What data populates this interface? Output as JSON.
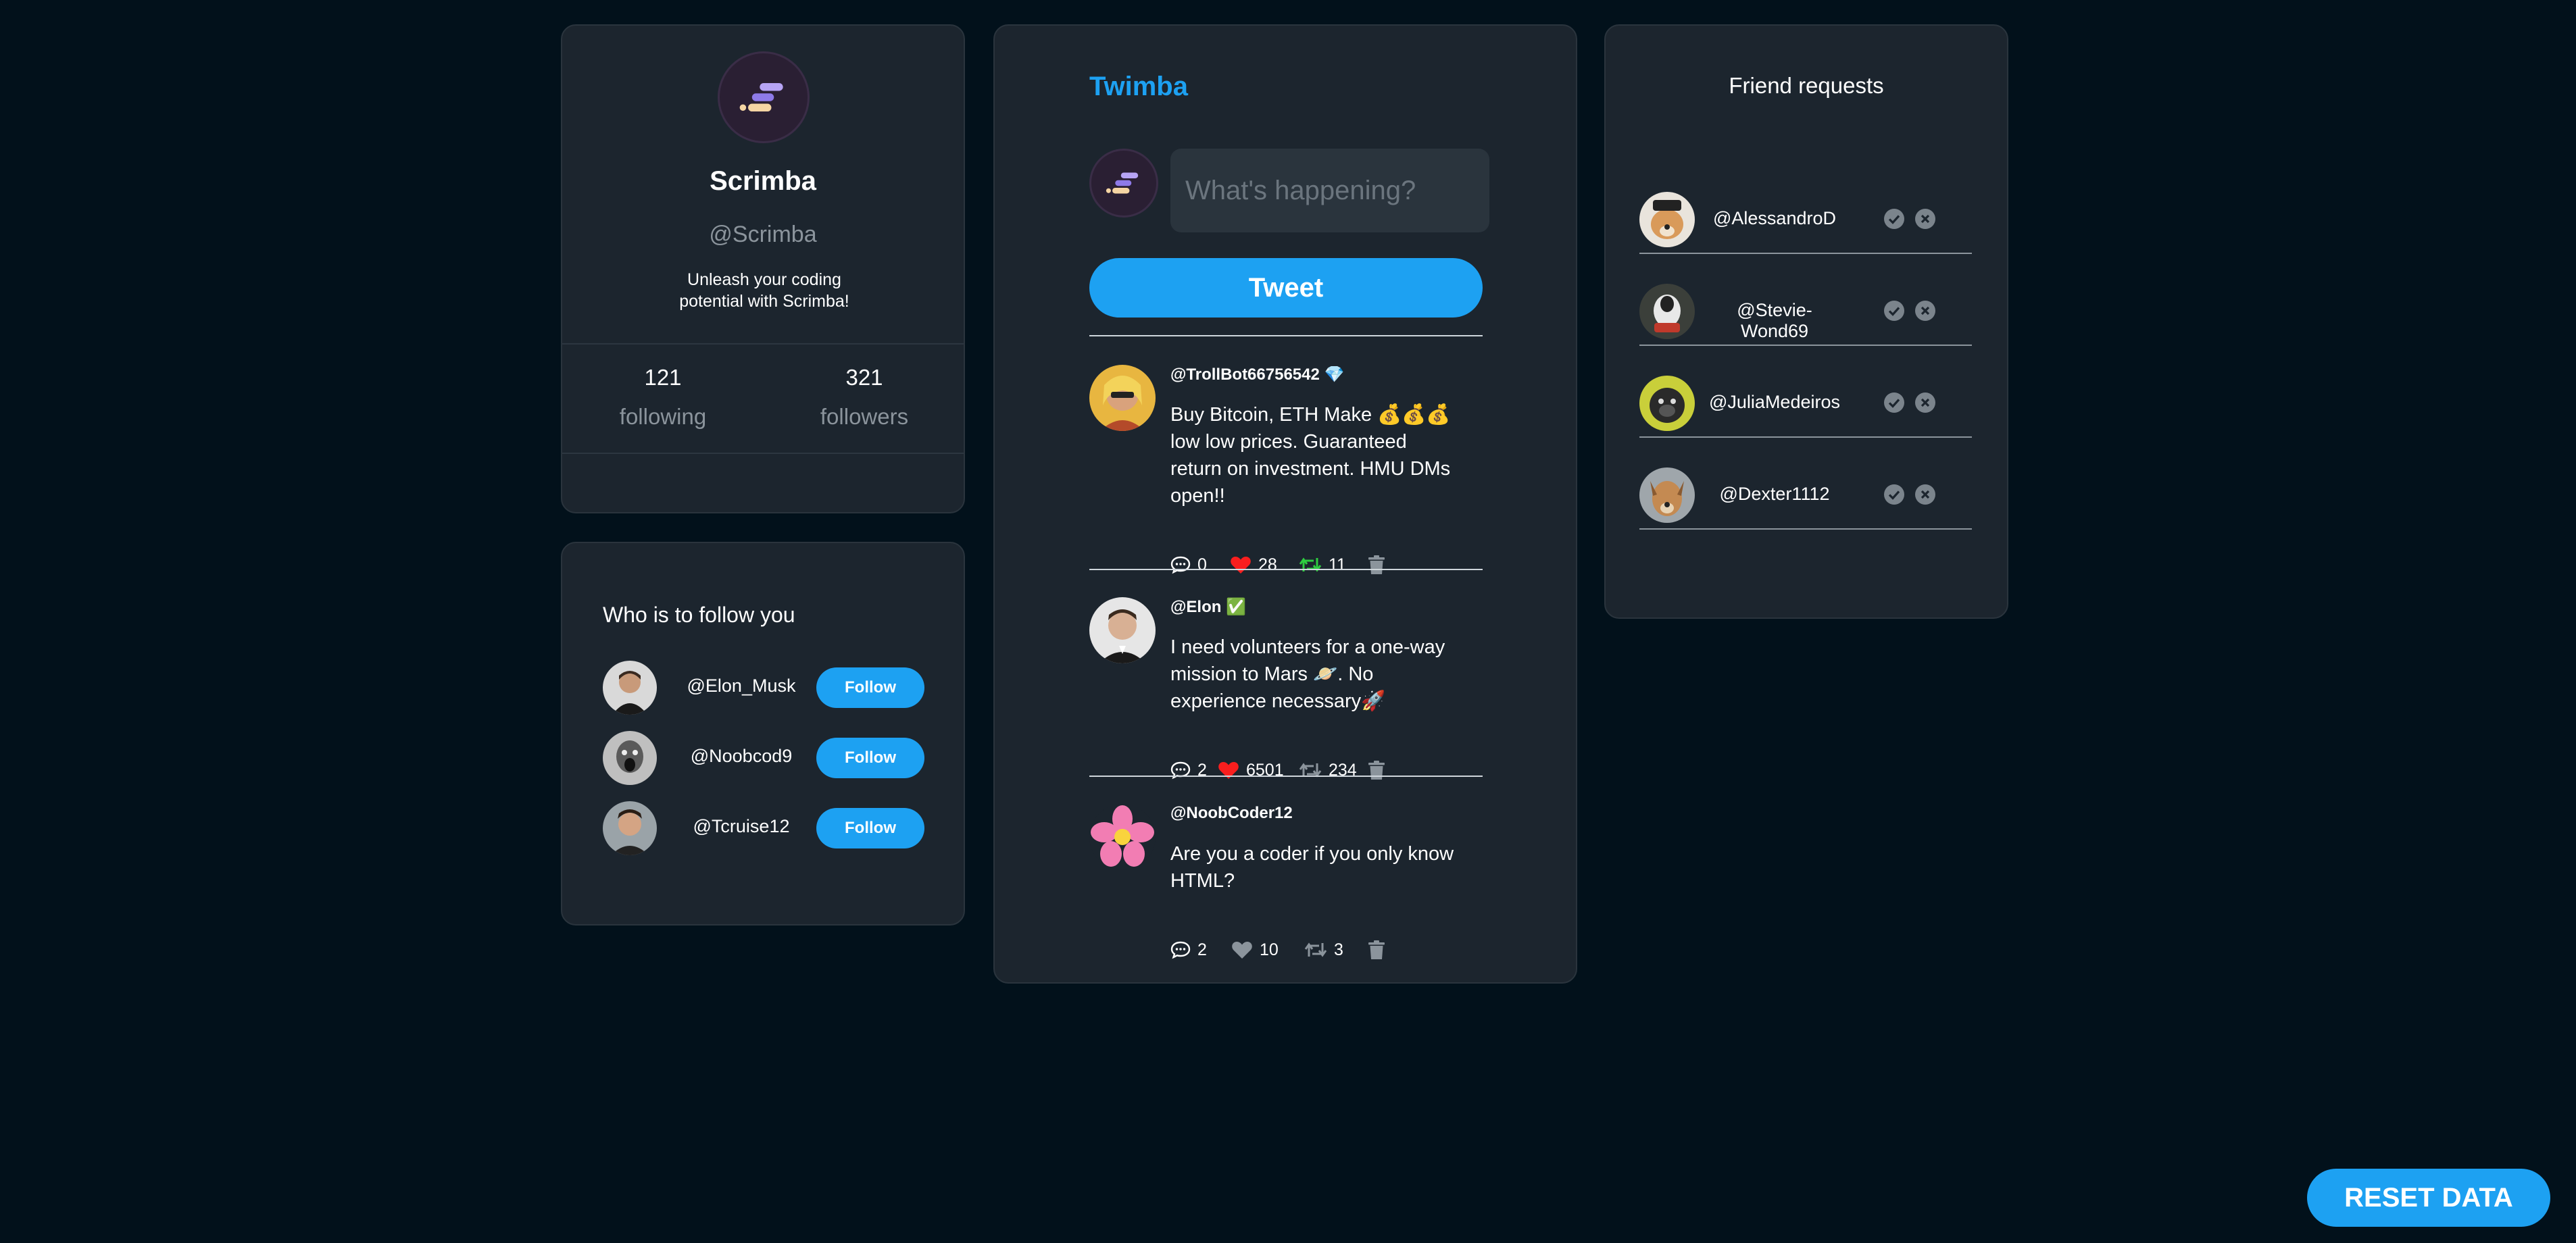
{
  "profile": {
    "name": "Scrimba",
    "handle": "@Scrimba",
    "bio": "Unleash your coding potential with Scrimba!",
    "following_count": "121",
    "following_label": "following",
    "followers_count": "321",
    "followers_label": "followers"
  },
  "who_to_follow": {
    "title": "Who is to follow you",
    "button_label": "Follow",
    "users": [
      {
        "handle": "@Elon_Musk"
      },
      {
        "handle": "@Noobcod9"
      },
      {
        "handle": "@Tcruise12"
      }
    ]
  },
  "feed": {
    "brand": "Twimba",
    "input_placeholder": "What's happening?",
    "tweet_button": "Tweet",
    "tweets": [
      {
        "handle": "@TrollBot66756542 💎",
        "text": "Buy Bitcoin, ETH Make 💰💰💰 low low prices. Guaranteed return on investment. HMU DMs open!!",
        "replies": "0",
        "likes": "28",
        "retweets": "11",
        "liked": true,
        "retweeted": true
      },
      {
        "handle": "@Elon ✅",
        "text": "I need volunteers for a one-way mission to Mars 🪐. No experience necessary🚀",
        "replies": "2",
        "likes": "6501",
        "retweets": "234",
        "liked": true,
        "retweeted": false
      },
      {
        "handle": "@NoobCoder12",
        "text": "Are you a coder if you only know HTML?",
        "replies": "2",
        "likes": "10",
        "retweets": "3",
        "liked": false,
        "retweeted": false
      }
    ]
  },
  "friend_requests": {
    "title": "Friend requests",
    "users": [
      {
        "handle": "@AlessandroD"
      },
      {
        "handle": "@Stevie-Wond69"
      },
      {
        "handle": "@JuliaMedeiros"
      },
      {
        "handle": "@Dexter1112"
      }
    ]
  },
  "reset_button": "RESET DATA",
  "colors": {
    "background": "#02111b",
    "panel": "#1c252e",
    "accent": "#1da1f2",
    "like_active": "#f91e1e",
    "retweet_active": "#2ecc40",
    "muted": "#8b949c"
  }
}
